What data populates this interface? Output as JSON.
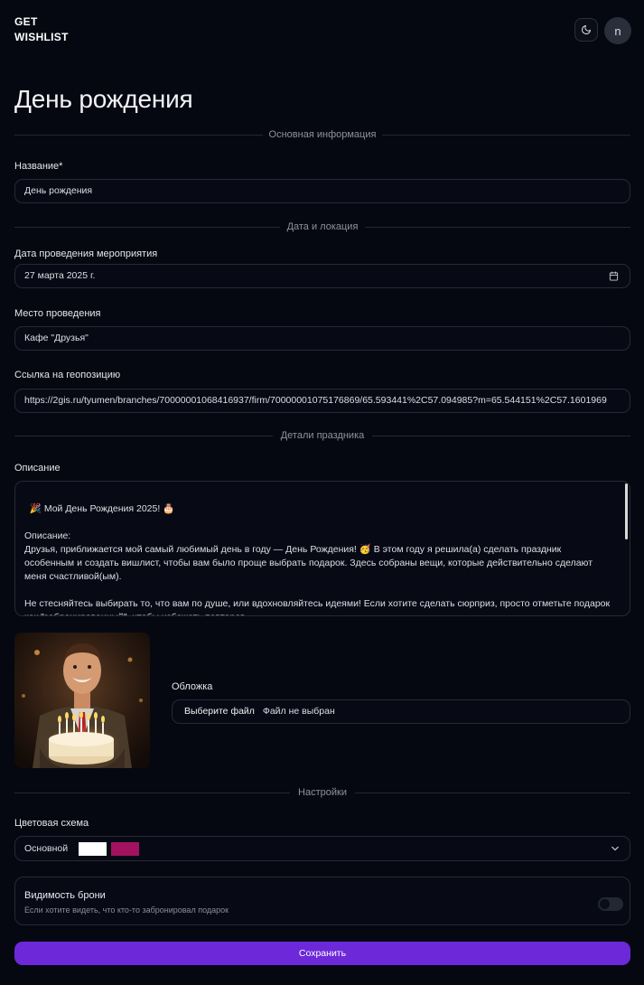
{
  "app": {
    "logo": "GET WISHLIST",
    "avatar_initial": "n"
  },
  "page": {
    "title": "День рождения"
  },
  "sections": {
    "basic": "Основная информация",
    "date_location": "Дата и локация",
    "details": "Детали праздника",
    "settings": "Настройки"
  },
  "name_field": {
    "label": "Название*",
    "value": "День рождения"
  },
  "date_field": {
    "label": "Дата проведения мероприятия",
    "value": "27 марта 2025 г."
  },
  "place_field": {
    "label": "Место проведения",
    "value": "Кафе \"Друзья\""
  },
  "geo_field": {
    "label": "Ссылка на геопозицию",
    "value": "https://2gis.ru/tyumen/branches/70000001068416937/firm/70000001075176869/65.593441%2C57.094985?m=65.544151%2C57.1601969"
  },
  "description": {
    "label": "Описание",
    "value": "🎉 Мой День Рождения 2025! 🎂\n\nОписание:\nДрузья, приближается мой самый любимый день в году — День Рождения! 🥳 В этом году я решила(а) сделать праздник особенным и создать вишлист, чтобы вам было проще выбрать подарок. Здесь собраны вещи, которые действительно сделают меня счастливой(ым).\n\nНе стесняйтесь выбирать то, что вам по душе, или вдохновляйтесь идеями! Если хотите сделать сюрприз, просто отметьте подарок как \"забронированный\", чтобы избежать повторов."
  },
  "cover": {
    "label": "Обложка",
    "button": "Выберите файл",
    "status": "Файл не выбран"
  },
  "color_scheme": {
    "label": "Цветовая схема",
    "value": "Основной",
    "swatch_colors": [
      "#ffffff",
      "#a3125f"
    ]
  },
  "booking_visibility": {
    "title": "Видимость брони",
    "subtitle": "Если хотите видеть, что кто-то забронировал подарок",
    "enabled": false
  },
  "save_button": "Сохранить",
  "colors": {
    "accent": "#6d28d9",
    "background": "#050811"
  }
}
